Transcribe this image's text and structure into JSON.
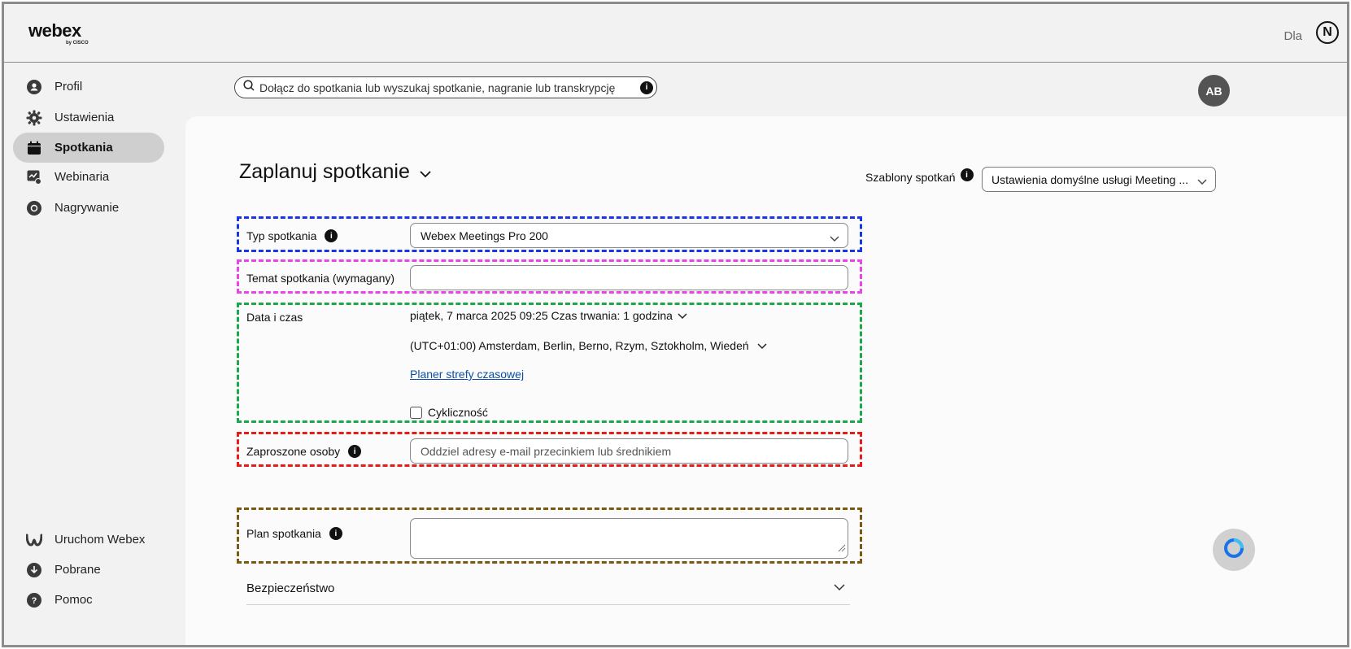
{
  "header": {
    "logo_main": "webex",
    "logo_sub": "by CISCO",
    "for_label": "Dla",
    "brand_badge": "N"
  },
  "sidebar": {
    "top_items": [
      {
        "label": "Profil",
        "icon": "profile-icon"
      },
      {
        "label": "Ustawienia",
        "icon": "gear-icon"
      },
      {
        "label": "Spotkania",
        "icon": "calendar-icon",
        "active": true
      },
      {
        "label": "Webinaria",
        "icon": "webinar-icon"
      },
      {
        "label": "Nagrywanie",
        "icon": "recording-icon"
      }
    ],
    "bottom_items": [
      {
        "label": "Uruchom Webex",
        "icon": "webex-icon"
      },
      {
        "label": "Pobrane",
        "icon": "download-icon"
      },
      {
        "label": "Pomoc",
        "icon": "help-icon"
      }
    ]
  },
  "search": {
    "placeholder": "Dołącz do spotkania lub wyszukaj spotkanie, nagranie lub transkrypcję"
  },
  "user": {
    "initials": "AB"
  },
  "main": {
    "title": "Zaplanuj spotkanie",
    "templates_label": "Szablony spotkań",
    "templates_value": "Ustawienia domyślne usługi Meeting ...",
    "meeting_type": {
      "label": "Typ spotkania",
      "value": "Webex Meetings Pro 200"
    },
    "topic": {
      "label": "Temat spotkania (wymagany)",
      "value": ""
    },
    "datetime": {
      "label": "Data i czas",
      "when": "piątek, 7 marca 2025 09:25 Czas trwania: 1 godzina",
      "timezone": "(UTC+01:00) Amsterdam, Berlin, Berno, Rzym, Sztokholm, Wiedeń",
      "planner_link": "Planer strefy czasowej",
      "recurrence_label": "Cykliczność",
      "recurrence_checked": false
    },
    "invitees": {
      "label": "Zaproszone osoby",
      "placeholder": "Oddziel adresy e-mail przecinkiem lub średnikiem"
    },
    "agenda": {
      "label": "Plan spotkania",
      "value": ""
    },
    "security_section": "Bezpieczeństwo"
  },
  "colors": {
    "annotation_blue": "#1a35e8",
    "annotation_magenta": "#e844e8",
    "annotation_green": "#1aa84a",
    "annotation_red": "#e81a1a",
    "annotation_brown": "#7a5a10",
    "link": "#0b4fa5"
  }
}
